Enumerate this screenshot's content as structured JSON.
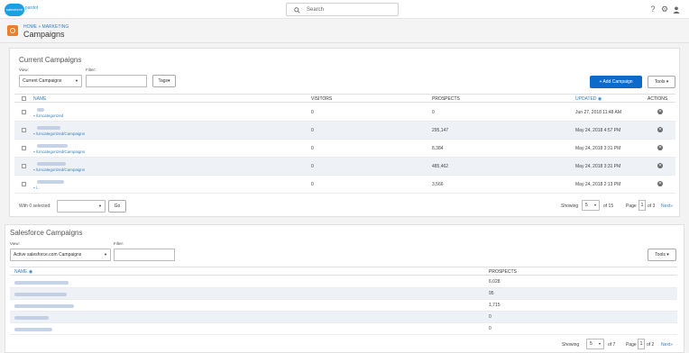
{
  "topbar": {
    "logo_text": "salesforce",
    "product": "pardot",
    "search_placeholder": "Search",
    "help": "?",
    "settings": "⚙",
    "user": "👤"
  },
  "header": {
    "breadcrumb": "HOME » MARKETING",
    "title": "Campaigns"
  },
  "current": {
    "title": "Current Campaigns",
    "view_label": "View:",
    "view_value": "Current Campaigns",
    "filter_label": "Filter:",
    "tags_label": "Tags",
    "add_label": "+ Add Campaign",
    "tools_label": "Tools",
    "columns": {
      "name": "NAME",
      "visitors": "VISITORS",
      "prospects": "PROSPECTS",
      "updated": "UPDATED",
      "actions": "ACTIONS"
    },
    "rows": [
      {
        "path": "/Uncategorized",
        "visitors": "0",
        "prospects": "0",
        "updated": "Jun 27, 2018 11:48 AM"
      },
      {
        "path": "/Uncategorized/Campaigns",
        "visitors": "0",
        "prospects": "295,147",
        "updated": "May 24, 2018 4:57 PM"
      },
      {
        "path": "/Uncategorized/Campaigns",
        "visitors": "0",
        "prospects": "8,384",
        "updated": "May 24, 2018 3:31 PM"
      },
      {
        "path": "/Uncategorized/Campaigns",
        "visitors": "0",
        "prospects": "485,462",
        "updated": "May 24, 2018 3:31 PM"
      },
      {
        "path": "/..",
        "visitors": "0",
        "prospects": "3,566",
        "updated": "May 24, 2018 2:13 PM"
      }
    ],
    "with_selected": "With 0 selected:",
    "go_label": "Go",
    "showing_label": "Showing",
    "showing_value": "5",
    "of_label": "of 15",
    "page_label": "Page",
    "page_value": "1",
    "page_of": "of 3",
    "next_label": "Next»"
  },
  "salesforce": {
    "title": "Salesforce Campaigns",
    "view_label": "View:",
    "view_value": "Active salesforce.com Campaigns",
    "filter_label": "Filter:",
    "tools_label": "Tools",
    "columns": {
      "name": "NAME",
      "prospects": "PROSPECTS"
    },
    "rows": [
      {
        "prospects": "6,028"
      },
      {
        "prospects": "95"
      },
      {
        "prospects": "1,715"
      },
      {
        "prospects": "0"
      },
      {
        "prospects": "0"
      }
    ],
    "showing_label": "Showing",
    "showing_value": "5",
    "of_label": "of 7",
    "page_label": "Page",
    "page_value": "1",
    "page_of": "of 2",
    "next_label": "Next»"
  }
}
